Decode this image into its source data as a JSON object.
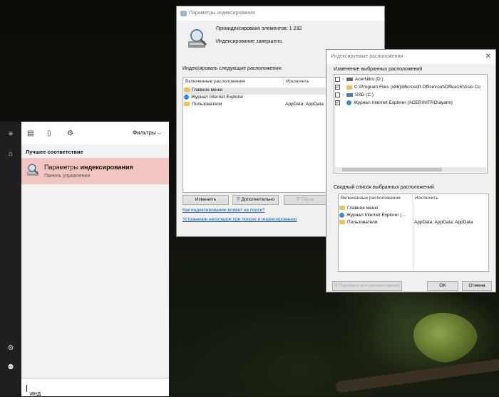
{
  "start_menu": {
    "filters_label": "Фильтры",
    "best_match_label": "Лучшее соответствие",
    "result_title_prefix": "Параметры ",
    "result_title_bold": "индексирования",
    "result_subtitle": "Панель управления",
    "search_query": "инд"
  },
  "indexing_window": {
    "title": "Параметры индексирования",
    "items_indexed": "Проиндексировано элементов: 1 232",
    "status": "Индексирование завершено.",
    "index_locations_label": "Индексировать следующие расположения:",
    "columns": [
      "Включенные расположения",
      "Исключить"
    ],
    "rows": [
      {
        "name": "Главное меню",
        "exclude": ""
      },
      {
        "name": "Журнал Internet Explorer",
        "exclude": ""
      },
      {
        "name": "Пользователи",
        "exclude": "AppData; AppData"
      }
    ],
    "modify_button": "Изменить",
    "advanced_button": "Дополнительно",
    "pause_button": "Пауза",
    "link_how": "Как индексирование влияет на поиск?",
    "link_troubleshoot": "Устранение неполадок при поиске и индексировании"
  },
  "locations_window": {
    "title": "Индексируемые расположения",
    "change_label": "Изменение выбранных расположений",
    "tree": [
      {
        "label": "AcerNitro (D:)",
        "checked": false,
        "expandable": true
      },
      {
        "label": "C:\\Program Files (x86)\\Microsoft Office\\root\\Office16\\Visio Co",
        "checked": true,
        "expandable": false
      },
      {
        "label": "SSD (C:)",
        "checked": false,
        "expandable": true
      },
      {
        "label": "Журнал Internet Explorer (ACER\\NITRO\\ayami)",
        "checked": true,
        "expandable": false
      }
    ],
    "summary_label": "Сводный список выбранных расположений",
    "columns": [
      "Включенные расположения",
      "Исключить"
    ],
    "rows": [
      {
        "name": "Главное меню",
        "exclude": ""
      },
      {
        "name": "Журнал Internet Explorer (...",
        "exclude": ""
      },
      {
        "name": "Пользователи",
        "exclude": "AppData; AppData; AppData"
      }
    ],
    "show_all_button": "Показать все расположения",
    "ok_button": "OK",
    "cancel_button": "Отмена"
  },
  "colors": {
    "highlight": "#f2c5c0",
    "link": "#1a5fb4"
  }
}
